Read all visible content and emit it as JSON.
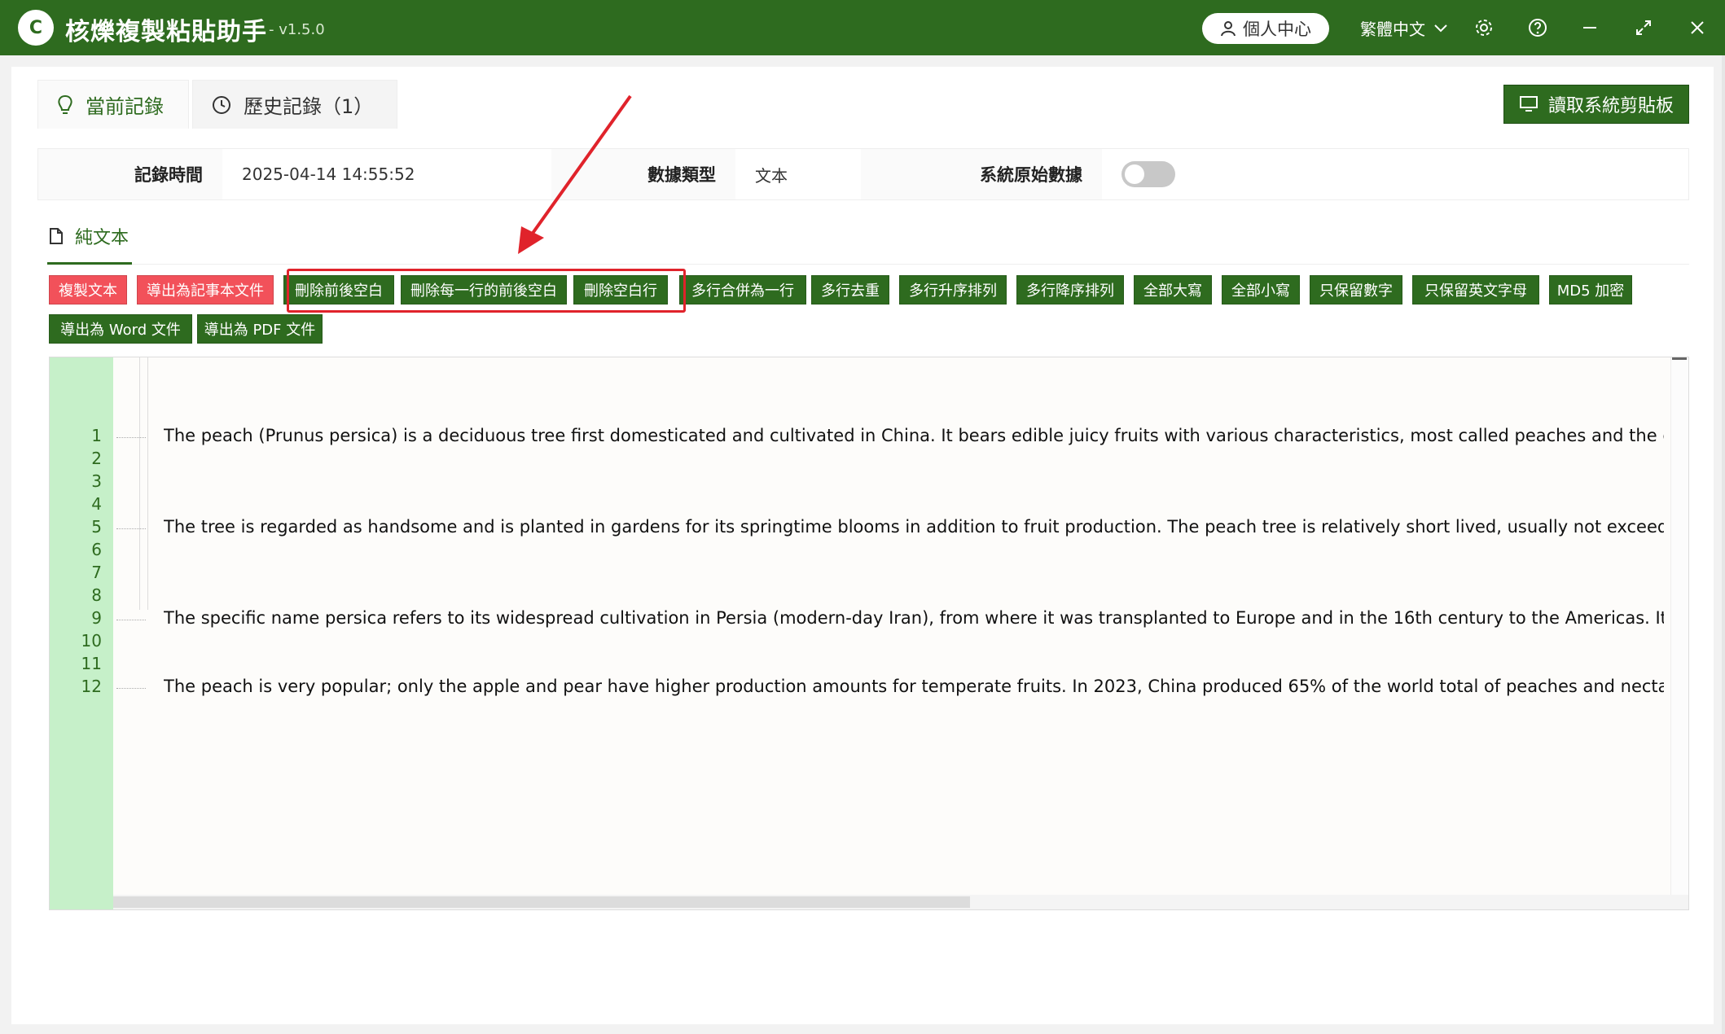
{
  "app": {
    "logo_text": "C",
    "title": "核爍複製粘貼助手",
    "version": "- v1.5.0",
    "user_center": "個人中心",
    "language": "繁體中文",
    "accent_color": "#2e6b1f",
    "danger_color": "#f2515a"
  },
  "tabs": [
    {
      "label": "當前記錄",
      "icon": "lightbulb-icon",
      "active": true
    },
    {
      "label": "歷史記錄（1）",
      "icon": "history-icon",
      "active": false
    }
  ],
  "read_clipboard_button": "讀取系統剪貼板",
  "info": {
    "record_time_label": "記錄時間",
    "record_time_value": "2025-04-14 14:55:52",
    "data_type_label": "數據類型",
    "data_type_value": "文本",
    "raw_data_label": "系統原始數據",
    "raw_data_enabled": false
  },
  "subtab": {
    "label": "純文本",
    "icon": "document-icon"
  },
  "toolbar": {
    "copy_text": "複製文本",
    "export_txt": "導出為記事本文件",
    "trim_whitespace": "刪除前後空白",
    "trim_each_line": "刪除每一行的前後空白",
    "remove_blank_lines": "刪除空白行",
    "merge_lines": "多行合併為一行",
    "dedupe_lines": "多行去重",
    "sort_asc": "多行升序排列",
    "sort_desc": "多行降序排列",
    "uppercase": "全部大寫",
    "lowercase": "全部小寫",
    "keep_digits": "只保留數字",
    "keep_letters": "只保留英文字母",
    "md5": "MD5 加密",
    "export_word": "導出為 Word 文件",
    "export_pdf": "導出為 PDF 文件"
  },
  "editor": {
    "line_numbers": [
      "1",
      "2",
      "3",
      "4",
      "5",
      "6",
      "7",
      "8",
      "9",
      "10",
      "11",
      "12"
    ],
    "lines": [
      "The peach (Prunus persica) is a deciduous tree first domesticated and cultivated in China. It bears edible juicy fruits with various characteristics, most called peaches and the glossy-skinned",
      "",
      "",
      "",
      "The tree is regarded as handsome and is planted in gardens for its springtime blooms in addition to fruit production. The peach tree is relatively short lived, usually not exceeding twenty",
      "",
      "",
      "",
      "The specific name persica refers to its widespread cultivation in Persia (modern-day Iran), from where it was transplanted to Europe and in the 16th century to the Americas. It belongs to",
      "",
      "",
      "The peach is very popular; only the apple and pear have higher production amounts for temperate fruits. In 2023, China produced 65% of the world total of peaches and nectarines. Other"
    ]
  }
}
